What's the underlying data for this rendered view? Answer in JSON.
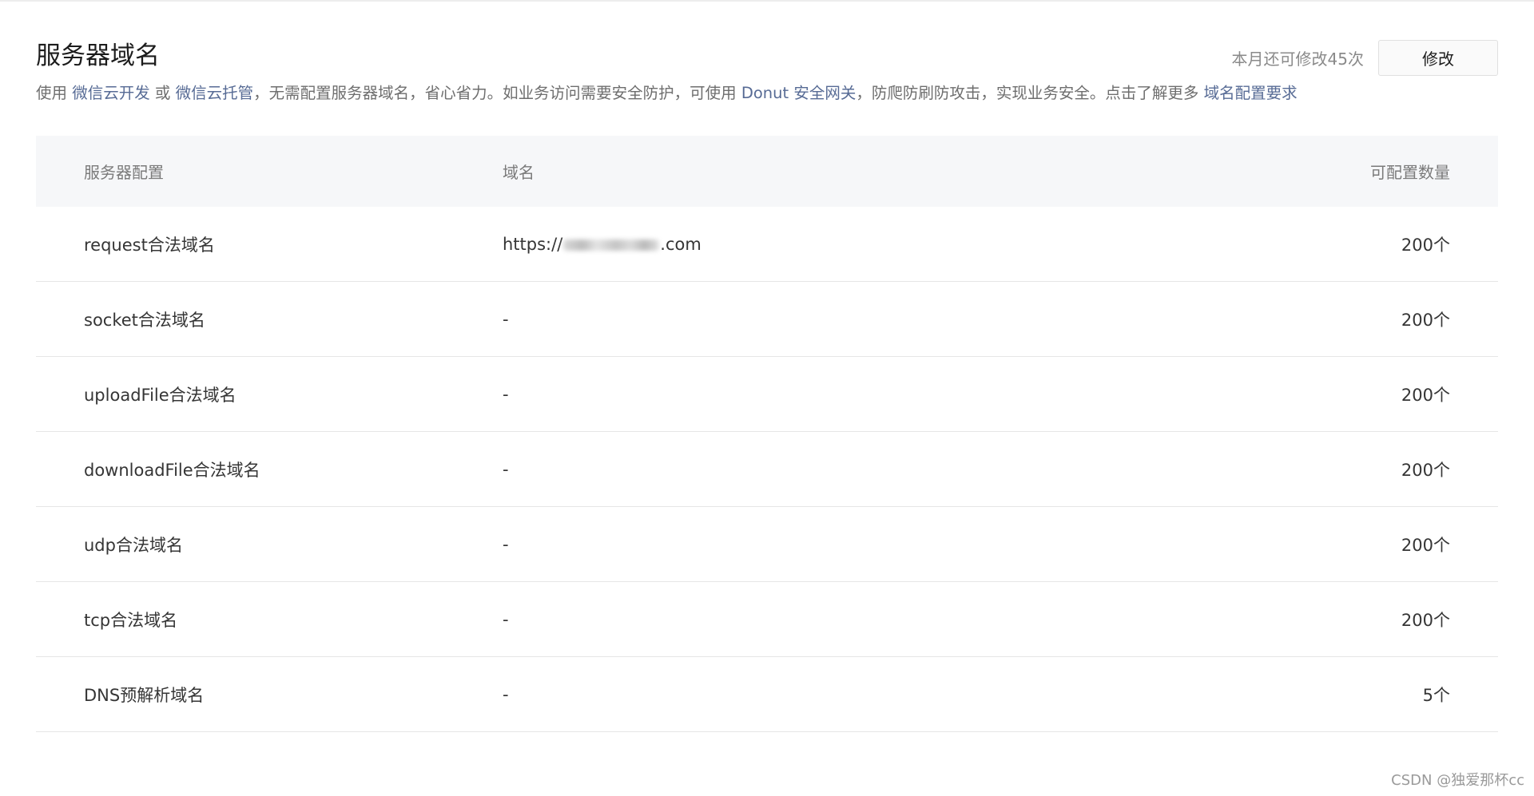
{
  "header": {
    "title": "服务器域名",
    "remaining": "本月还可修改45次",
    "modify_label": "修改"
  },
  "description": {
    "p1": "使用 ",
    "link1": "微信云开发",
    "p2": " 或 ",
    "link2": "微信云托管",
    "p3": "，无需配置服务器域名，省心省力。如业务访问需要安全防护，可使用 ",
    "link3": "Donut 安全网关",
    "p4": "，防爬防刷防攻击，实现业务安全。点击了解更多 ",
    "link4": "域名配置要求"
  },
  "table": {
    "headers": [
      "服务器配置",
      "域名",
      "可配置数量"
    ],
    "rows": [
      {
        "config": "request合法域名",
        "domain_prefix": "https://",
        "domain_suffix": ".com",
        "count": "200个"
      },
      {
        "config": "socket合法域名",
        "domain": "-",
        "count": "200个"
      },
      {
        "config": "uploadFile合法域名",
        "domain": "-",
        "count": "200个"
      },
      {
        "config": "downloadFile合法域名",
        "domain": "-",
        "count": "200个"
      },
      {
        "config": "udp合法域名",
        "domain": "-",
        "count": "200个"
      },
      {
        "config": "tcp合法域名",
        "domain": "-",
        "count": "200个"
      },
      {
        "config": "DNS预解析域名",
        "domain": "-",
        "count": "5个"
      }
    ]
  },
  "watermark": "CSDN @独爱那杯cc",
  "colors": {
    "link": "#576b95",
    "header_bg": "#f6f7f9",
    "border": "#e6e6e6"
  }
}
